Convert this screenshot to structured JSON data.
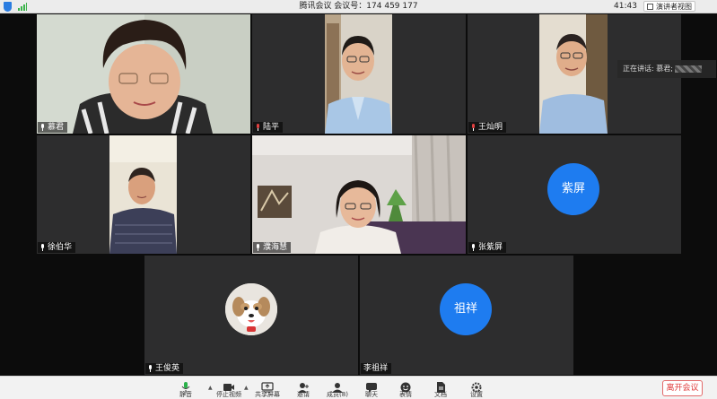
{
  "titlebar": {
    "title": "腾讯会议  会议号：174 459 177",
    "timer": "41:43",
    "view_button": "演讲者视图"
  },
  "speaking": {
    "label": "正在讲话: 慕君;"
  },
  "participants": [
    {
      "name": "慕君",
      "mic": "on"
    },
    {
      "name": "陆平",
      "mic": "muted"
    },
    {
      "name": "王灿明",
      "mic": "muted"
    },
    {
      "name": "徐伯华",
      "mic": "on"
    },
    {
      "name": "濮海慧",
      "mic": "on"
    },
    {
      "name": "张紫屏",
      "mic": "on",
      "avatar_text": "紫屏"
    },
    {
      "name": "王俊英",
      "mic": "on"
    },
    {
      "name": "李祖祥",
      "mic": "none",
      "avatar_text": "祖祥"
    }
  ],
  "toolbar": {
    "items": [
      {
        "label": "静音",
        "icon": "mic-icon"
      },
      {
        "label": "停止视频",
        "icon": "video-camera-icon"
      },
      {
        "label": "共享屏幕",
        "icon": "share-screen-icon"
      },
      {
        "label": "邀请",
        "icon": "invite-icon"
      },
      {
        "label": "成员(8)",
        "icon": "members-icon"
      },
      {
        "label": "聊天",
        "icon": "chat-icon"
      },
      {
        "label": "表情",
        "icon": "emoji-icon"
      },
      {
        "label": "文档",
        "icon": "document-icon"
      },
      {
        "label": "设置",
        "icon": "settings-icon"
      }
    ],
    "leave_label": "离开会议"
  },
  "colors": {
    "active_speaker_border": "#29b24a",
    "avatar_blue": "#1e7cf0",
    "leave_red": "#e03b3b",
    "mic_green": "#29b24a"
  }
}
